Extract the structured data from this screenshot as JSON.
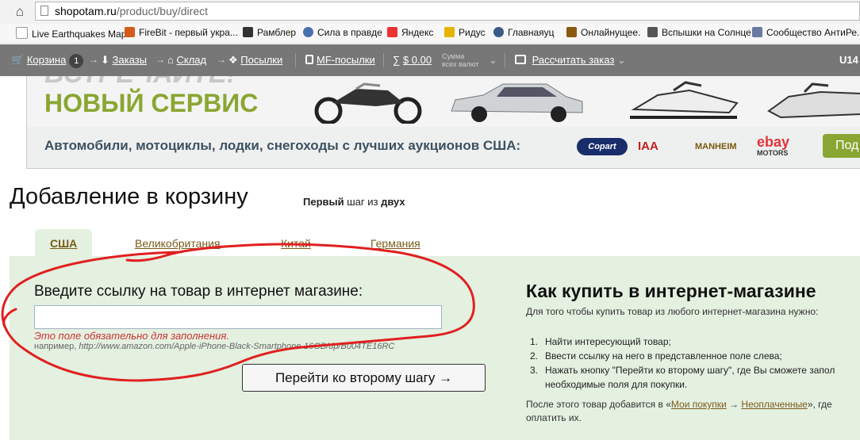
{
  "browser": {
    "url_host": "shopotam.ru",
    "url_path": "/product/buy/direct",
    "bookmarks": [
      "Live Earthquakes Map",
      "FireBit - первый укра...",
      "Рамблер",
      "Сила в правде",
      "Яндекс",
      "Ридус",
      "Главнаяуц",
      "Онлайнущее.",
      "Вспышки на Солнце",
      "Сообщество АнтиРе..."
    ]
  },
  "topbar": {
    "cart": "Корзина",
    "cart_count": "1",
    "orders": "Заказы",
    "warehouse": "Склад",
    "parcels": "Посылки",
    "mf_parcels": "MF-посылки",
    "sigma": "∑",
    "amount": "$ 0.00",
    "sum_label_1": "Сумма",
    "sum_label_2": "всех валют",
    "calc": "Рассчитать заказ",
    "user": "U14"
  },
  "banner": {
    "ghost": "ВСТРЕЧАЙТЕ!",
    "title": "НОВЫЙ СЕРВИС",
    "subtitle": "Автомобили, мотоциклы, лодки, снегоходы с лучших аукционов США:",
    "logos": [
      "Copart",
      "IAA",
      "MANHEIM",
      "ebay",
      "MOTORS"
    ],
    "button": "Под"
  },
  "page": {
    "title": "Добавление в корзину",
    "step_first": "Первый",
    "step_mid": "шаг из",
    "step_two": "двух"
  },
  "tabs": [
    "США",
    "Великобритания",
    "Китай",
    "Германия"
  ],
  "form": {
    "label": "Введите ссылку на товар в интернет магазине:",
    "value": "",
    "error": "Это поле обязательно для заполнения.",
    "example_prefix": "например,",
    "example_url": "http://www.amazon.com/Apple-iPhone-Black-Smartphone-16GB/dp/B004TE16RC",
    "submit": "Перейти ко второму шагу →"
  },
  "help": {
    "heading": "Как купить в интернет-магазине",
    "intro": "Для того чтобы купить товар из любого интернет-магазина нужно:",
    "steps": [
      "Найти интересующий товар;",
      "Ввести ссылку на него в представленное поле слева;",
      "Нажать кнопку \"Перейти ко второму шагу\", где Вы сможете запол",
      "необходимые поля для покупки."
    ],
    "after_1": "После этого товар добавится в «",
    "link_1": "Мои покупки",
    "arrow": " → ",
    "link_2": "Неоплаченные",
    "after_2": "», где",
    "after_3": "оплатить их."
  },
  "colors": {
    "accent": "#8aa632",
    "panel": "#e4f0e0",
    "topbar": "#777777",
    "error": "#cc3333",
    "annotation": "#e02020"
  }
}
